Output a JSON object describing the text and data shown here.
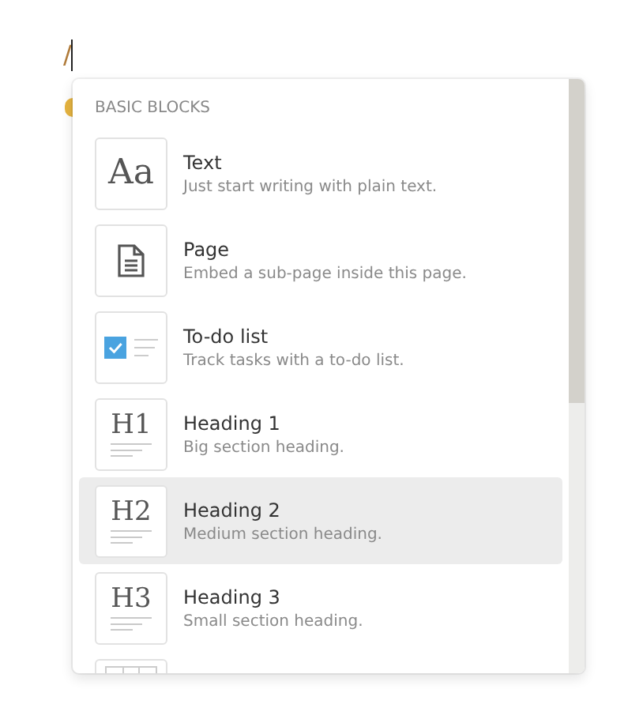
{
  "editor": {
    "text": "/"
  },
  "menu": {
    "section": "BASIC BLOCKS",
    "items": [
      {
        "kind": "text",
        "glyph": "Aa",
        "label": "Text",
        "description": "Just start writing with plain text.",
        "selected": false
      },
      {
        "kind": "page",
        "label": "Page",
        "description": "Embed a sub-page inside this page.",
        "selected": false
      },
      {
        "kind": "todo",
        "label": "To-do list",
        "description": "Track tasks with a to-do list.",
        "selected": false
      },
      {
        "kind": "heading",
        "glyph": "H1",
        "label": "Heading 1",
        "description": "Big section heading.",
        "selected": false
      },
      {
        "kind": "heading",
        "glyph": "H2",
        "label": "Heading 2",
        "description": "Medium section heading.",
        "selected": true
      },
      {
        "kind": "heading",
        "glyph": "H3",
        "label": "Heading 3",
        "description": "Small section heading.",
        "selected": false
      },
      {
        "kind": "table",
        "selected": false
      }
    ]
  }
}
